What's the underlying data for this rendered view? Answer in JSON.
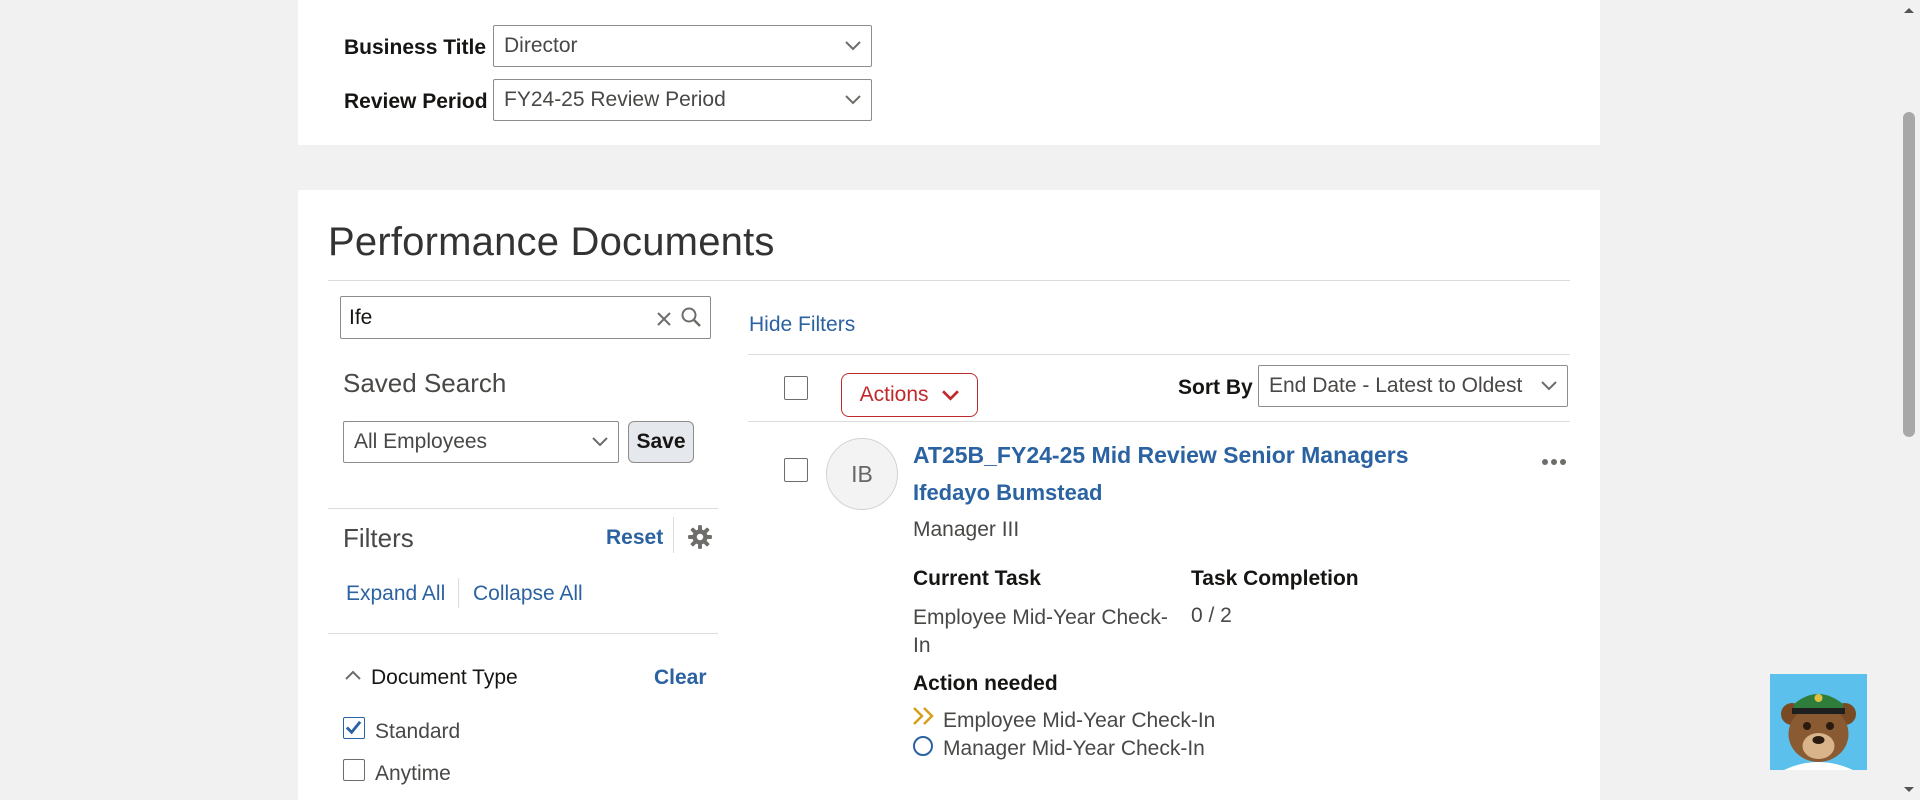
{
  "review_form": {
    "business_title_label": "Business Title",
    "business_title_value": "Director",
    "review_period_label": "Review Period",
    "review_period_value": "FY24-25 Review Period"
  },
  "documents": {
    "title": "Performance Documents",
    "search_value": "Ife",
    "hide_filters_label": "Hide Filters",
    "saved_search_label": "Saved Search",
    "saved_search_value": "All Employees",
    "save_label": "Save",
    "filters_label": "Filters",
    "reset_label": "Reset",
    "expand_all_label": "Expand All",
    "collapse_all_label": "Collapse All",
    "document_type": {
      "label": "Document Type",
      "clear_label": "Clear",
      "options": [
        {
          "label": "Standard",
          "checked": true
        },
        {
          "label": "Anytime",
          "checked": false
        }
      ]
    },
    "actions_label": "Actions",
    "sort_by_label": "Sort By",
    "sort_by_value": "End Date - Latest to Oldest",
    "results": [
      {
        "initials": "IB",
        "document_name": "AT25B_FY24-25 Mid Review Senior Managers",
        "employee_name": "Ifedayo Bumstead",
        "job_title": "Manager III",
        "current_task_label": "Current Task",
        "current_task_value": "Employee Mid-Year Check-In",
        "task_completion_label": "Task Completion",
        "task_completion_value": "0 / 2",
        "action_needed_label": "Action needed",
        "actions": [
          "Employee Mid-Year Check-In",
          "Manager Mid-Year Check-In"
        ]
      }
    ]
  },
  "icons": {
    "clear": "close-icon",
    "search": "search-icon",
    "settings": "gear-icon",
    "more": "more-options-icon",
    "expand": "chevron-up-icon",
    "chevron": "chevron-down-icon",
    "current_step": "double-chevron-right-icon",
    "pending_step": "circle-icon",
    "assistant": "bear-mascot-icon"
  },
  "colors": {
    "link": "#2b62a1",
    "actions_accent": "#c0292c",
    "step_current": "#d6a01e",
    "step_pending": "#2b62a1",
    "assistant_bg": "#5bc0eb"
  }
}
